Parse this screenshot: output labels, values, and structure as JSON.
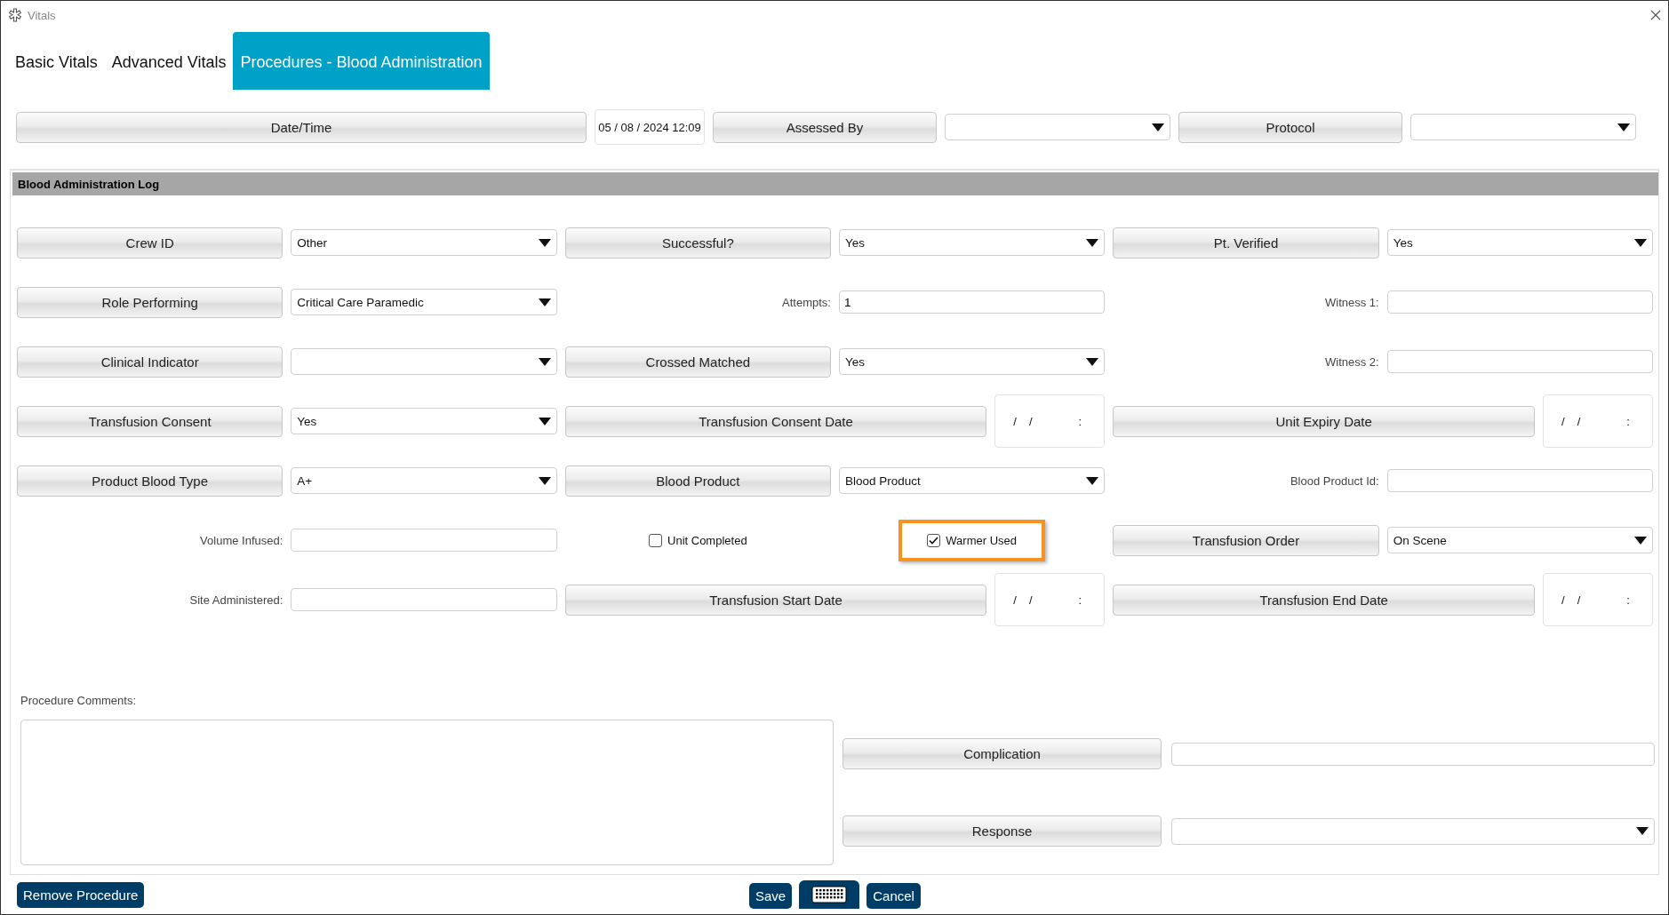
{
  "window": {
    "title": "Vitals"
  },
  "tabs": [
    {
      "label": "Basic Vitals",
      "selected": false
    },
    {
      "label": "Advanced Vitals",
      "selected": false
    },
    {
      "label": "Procedures - Blood Administration",
      "selected": true
    }
  ],
  "header_fields": [
    {
      "kind": "datetime",
      "label": "Date/Time",
      "value": "05 / 08 / 2024  12:09"
    },
    {
      "kind": "select",
      "label": "Assessed By"
    },
    {
      "kind": "select",
      "label": "Protocol"
    }
  ],
  "log": {
    "title": "Blood Administration Log",
    "rows": [
      [
        {
          "kind": "button",
          "label": "Crew ID"
        },
        {
          "kind": "select",
          "value": "Other"
        },
        {
          "kind": "button",
          "label": "Successful?"
        },
        {
          "kind": "select",
          "value": "Yes"
        },
        {
          "kind": "button",
          "label": "Pt. Verified"
        },
        {
          "kind": "select",
          "value": "Yes"
        }
      ],
      [
        {
          "kind": "button",
          "label": "Role Performing"
        },
        {
          "kind": "select",
          "value": "Critical Care Paramedic"
        },
        {
          "kind": "label",
          "label": "Attempts:"
        },
        {
          "kind": "input",
          "value": "1"
        },
        {
          "kind": "label",
          "label": "Witness 1:"
        },
        {
          "kind": "input"
        }
      ],
      [
        {
          "kind": "button",
          "label": "Clinical Indicator"
        },
        {
          "kind": "select"
        },
        {
          "kind": "button",
          "label": "Crossed Matched"
        },
        {
          "kind": "select",
          "value": "Yes"
        },
        {
          "kind": "label",
          "label": "Witness 2:"
        },
        {
          "kind": "input"
        }
      ],
      [
        {
          "kind": "button",
          "label": "Transfusion Consent"
        },
        {
          "kind": "select",
          "value": "Yes"
        },
        {
          "kind": "button",
          "label": "Transfusion Consent Date"
        },
        {
          "kind": "date",
          "marks": [
            "/",
            "/",
            ":"
          ]
        },
        {
          "kind": "button",
          "label": "Unit Expiry Date"
        },
        {
          "kind": "date",
          "marks": [
            "/",
            "/",
            ":"
          ]
        }
      ],
      [
        {
          "kind": "button",
          "label": "Product Blood Type"
        },
        {
          "kind": "select",
          "value": "A+"
        },
        {
          "kind": "button",
          "label": "Blood Product"
        },
        {
          "kind": "select",
          "value": "Blood Product"
        },
        {
          "kind": "label",
          "label": "Blood Product Id:"
        },
        {
          "kind": "input"
        }
      ],
      [
        {
          "kind": "label",
          "label": "Volume Infused:"
        },
        {
          "kind": "input"
        },
        {
          "kind": "checkbox",
          "label": "Unit Completed",
          "checked": false,
          "highlighted": false
        },
        {
          "kind": "checkbox",
          "label": "Warmer Used",
          "checked": true,
          "highlighted": true
        },
        {
          "kind": "button",
          "label": "Transfusion Order"
        },
        {
          "kind": "select",
          "value": "On Scene"
        }
      ],
      [
        {
          "kind": "label",
          "label": "Site Administered:"
        },
        {
          "kind": "input"
        },
        {
          "kind": "button",
          "label": "Transfusion Start Date"
        },
        {
          "kind": "date",
          "marks": [
            "/",
            "/",
            ":"
          ]
        },
        {
          "kind": "button",
          "label": "Transfusion End Date"
        },
        {
          "kind": "date",
          "marks": [
            "/",
            "/",
            ":"
          ]
        }
      ]
    ]
  },
  "comments": {
    "label": "Procedure Comments:"
  },
  "side_fields": [
    {
      "kind": "input",
      "label": "Complication"
    },
    {
      "kind": "select",
      "label": "Response"
    }
  ],
  "footer": {
    "remove": "Remove Procedure",
    "save": "Save",
    "cancel": "Cancel"
  }
}
